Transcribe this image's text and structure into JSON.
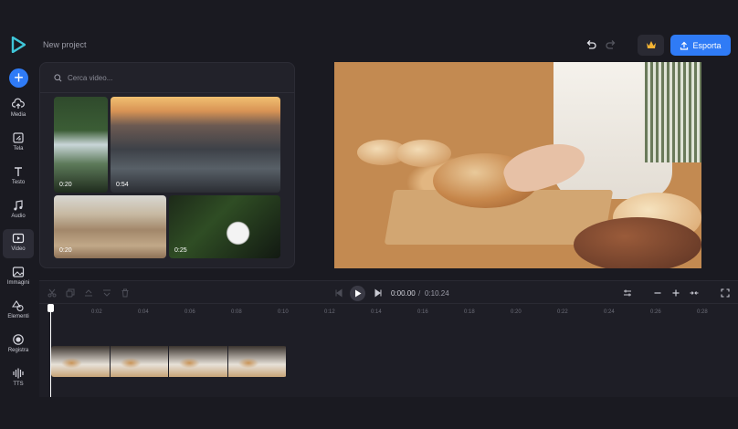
{
  "header": {
    "project_title": "New project",
    "export_label": "Esporta"
  },
  "sidebar": {
    "add_label": "+",
    "items": [
      {
        "label": "Media",
        "icon": "cloud-upload-icon"
      },
      {
        "label": "Tela",
        "icon": "canvas-icon"
      },
      {
        "label": "Testo",
        "icon": "text-icon"
      },
      {
        "label": "Audio",
        "icon": "music-note-icon"
      },
      {
        "label": "Video",
        "icon": "video-icon",
        "active": true
      },
      {
        "label": "Immagini",
        "icon": "image-icon"
      },
      {
        "label": "Elementi",
        "icon": "shapes-icon"
      },
      {
        "label": "Registra",
        "icon": "record-icon"
      },
      {
        "label": "TTS",
        "icon": "waveform-icon"
      }
    ]
  },
  "library": {
    "search_placeholder": "Cerca video...",
    "thumbnails": [
      {
        "duration": "0:20",
        "subject": "waterfall"
      },
      {
        "duration": "0:54",
        "subject": "ocean-sunset"
      },
      {
        "duration": "0:20",
        "subject": "desert-dunes"
      },
      {
        "duration": "0:25",
        "subject": "christmas-ornament"
      }
    ]
  },
  "playback": {
    "current_time": "0:00.00",
    "separator": "/",
    "total_time": "0:10.24"
  },
  "timeline": {
    "ticks": [
      "0:02",
      "0:04",
      "0:06",
      "0:08",
      "0:10",
      "0:12",
      "0:14",
      "0:16",
      "0:18",
      "0:20",
      "0:22",
      "0:24",
      "0:26",
      "0:28"
    ],
    "clip_count": 4
  },
  "colors": {
    "accent": "#2f7bf6",
    "background": "#1a1a21",
    "panel": "#22222a"
  }
}
